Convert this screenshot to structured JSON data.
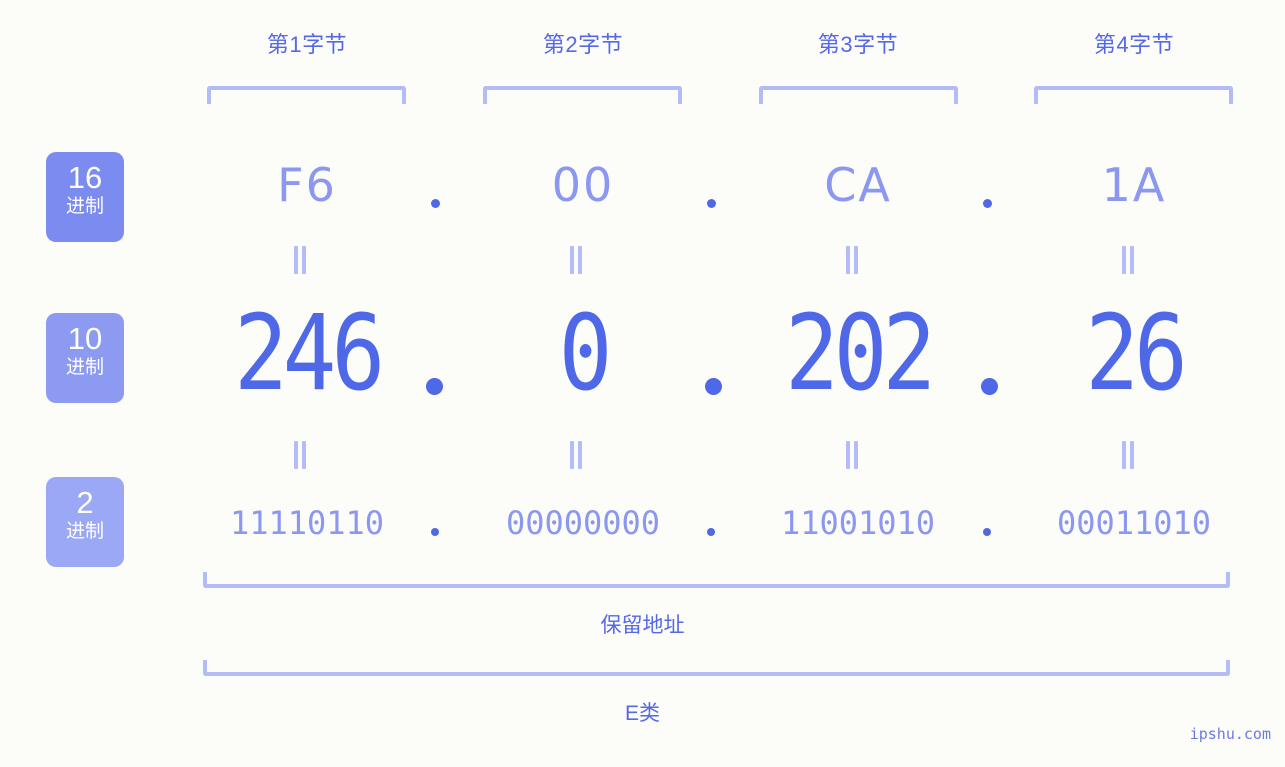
{
  "meta": {
    "background": "#fcfdf9",
    "accent": "#4f68e8",
    "accent_light": "#8b97f0",
    "bracket_color": "#b3bcf7",
    "watermark": "ipshu.com"
  },
  "byte_headers": [
    {
      "label": "第1字节"
    },
    {
      "label": "第2字节"
    },
    {
      "label": "第3字节"
    },
    {
      "label": "第4字节"
    }
  ],
  "bases": [
    {
      "num": "16",
      "unit": "进制",
      "color": "#7b8bf0"
    },
    {
      "num": "10",
      "unit": "进制",
      "color": "#8c9af2"
    },
    {
      "num": "2",
      "unit": "进制",
      "color": "#9aa8f5"
    }
  ],
  "rows": {
    "hex": {
      "sep": ".",
      "values": [
        "F6",
        "00",
        "CA",
        "1A"
      ]
    },
    "decimal": {
      "sep": ".",
      "values": [
        "246",
        "0",
        "202",
        "26"
      ]
    },
    "binary": {
      "sep": ".",
      "values": [
        "11110110",
        "00000000",
        "11001010",
        "00011010"
      ]
    }
  },
  "equals_symbol": "||",
  "spans": [
    {
      "caption": "保留地址"
    },
    {
      "caption": "E类"
    }
  ]
}
